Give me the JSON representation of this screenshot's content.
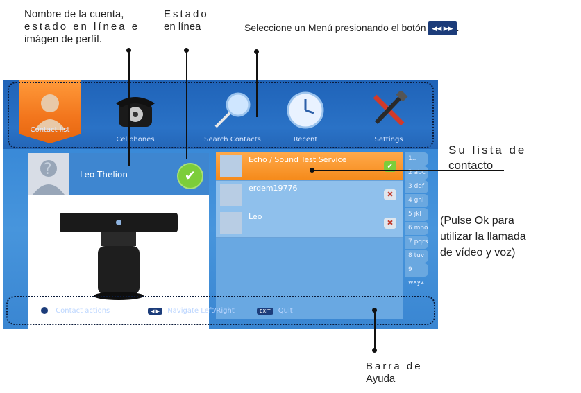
{
  "annotations": {
    "account_line1": "Nombre de la cuenta,",
    "account_line2": "estado en línea e",
    "account_line3": "imágen de perfíl.",
    "status_line1": "Estado",
    "status_line2": "en línea",
    "menu_hint": "Seleccione un Menú presionando el botón",
    "contacts_line1": "Su lista de",
    "contacts_line2": "contacto",
    "ok_line1": "(Pulse Ok para",
    "ok_line2": "utilizar la llamada",
    "ok_line3": "de vídeo y voz)",
    "helpbar_line1": "Barra de",
    "helpbar_line2": "Ayuda"
  },
  "menu": [
    {
      "label": "Contact list",
      "icon": "person-icon",
      "active": true
    },
    {
      "label": "Cellphones",
      "icon": "telephone-icon",
      "active": false
    },
    {
      "label": "Search Contacts",
      "icon": "magnifier-icon",
      "active": false
    },
    {
      "label": "Recent",
      "icon": "clock-icon",
      "active": false
    },
    {
      "label": "Settings",
      "icon": "tools-icon",
      "active": false
    }
  ],
  "profile": {
    "name": "Leo Thelion",
    "status": "online"
  },
  "contacts": [
    {
      "name": "Echo / Sound Test Service",
      "status": "online"
    },
    {
      "name": "erdem19776",
      "status": "offline"
    },
    {
      "name": "Leo",
      "status": "offline"
    }
  ],
  "alphabet": [
    "1..",
    "2 abc",
    "3 def",
    "4 ghi",
    "5 jkl",
    "6 mno",
    "7 pqrs",
    "8 tuv",
    "9 wxyz"
  ],
  "help": {
    "contact_actions": "Contact actions",
    "navigate": "Navigate Left/Right",
    "exit_key": "EXIT",
    "quit": "Quit"
  },
  "colors": {
    "accent": "#f2751c",
    "online": "#7ccd3a",
    "screen_bg": "#3a8ad8"
  }
}
